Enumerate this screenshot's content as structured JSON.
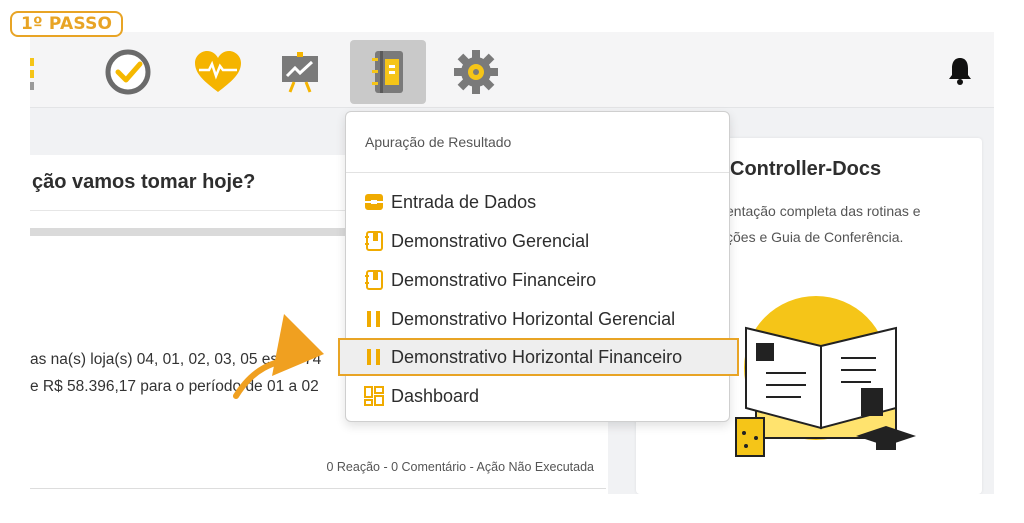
{
  "step": {
    "label": "1º PASSO"
  },
  "nav": {
    "icons": [
      "menu-icon",
      "clock-check-icon",
      "heart-pulse-icon",
      "chart-board-icon",
      "notebook-icon",
      "gear-icon"
    ],
    "active": "notebook-icon",
    "notification": "bell-icon"
  },
  "feed": {
    "question": "ção vamos tomar hoje?",
    "line1": "as na(s) loja(s) 04, 01, 02, 03, 05 estão 74",
    "line2": "e R$ 58.396,17 para o período de 01 a 02",
    "meta": "0 Reação - 0 Comentário - Ação Não Executada",
    "partial": "s"
  },
  "docs_card": {
    "title": "Controller-Docs",
    "line1": "entação completa das rotinas e",
    "line2": "ções e Guia de Conferência."
  },
  "dropdown": {
    "header": "Apuração de Resultado",
    "items": [
      {
        "label": "Entrada de Dados",
        "icon": "inbox-icon"
      },
      {
        "label": "Demonstrativo Gerencial",
        "icon": "notebook-icon"
      },
      {
        "label": "Demonstrativo Financeiro",
        "icon": "notebook-icon"
      },
      {
        "label": "Demonstrativo Horizontal Gerencial",
        "icon": "columns-icon"
      },
      {
        "label": "Demonstrativo Horizontal Financeiro",
        "icon": "columns-icon"
      },
      {
        "label": "Dashboard",
        "icon": "dashboard-icon"
      }
    ],
    "highlighted": "Demonstrativo Horizontal Financeiro"
  },
  "colors": {
    "accent": "#e8a425",
    "yellow": "#f5c518",
    "highlight_bg": "#eeeeee"
  }
}
